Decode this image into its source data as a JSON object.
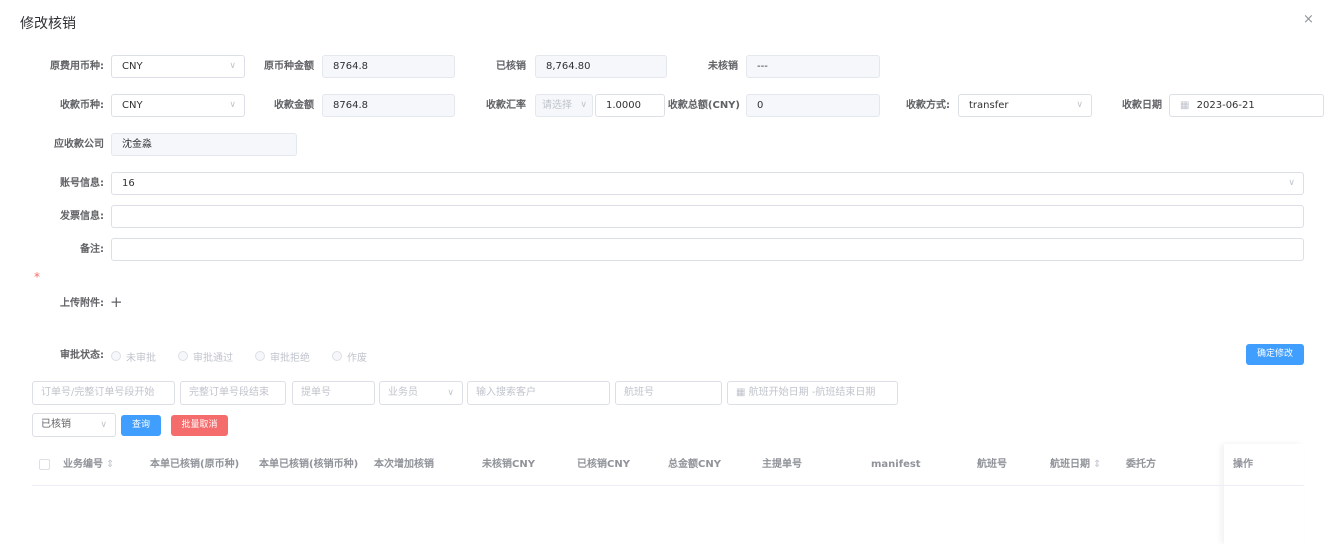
{
  "dialog": {
    "title": "修改核销",
    "close_icon": "×"
  },
  "row1": {
    "orig_currency": {
      "label": "原费用币种:",
      "value": "CNY"
    },
    "orig_amount": {
      "label": "原币种金额",
      "value": "8764.8"
    },
    "written_off": {
      "label": "已核销",
      "value": "8,764.80"
    },
    "not_written_off": {
      "label": "未核销",
      "value": "---"
    }
  },
  "row2": {
    "receipt_currency": {
      "label": "收款币种:",
      "value": "CNY"
    },
    "receipt_amount": {
      "label": "收款金额",
      "value": "8764.8"
    },
    "exchange_rate": {
      "label": "收款汇率",
      "select_placeholder": "请选择",
      "value": "1.0000"
    },
    "total_cny": {
      "label": "收款总额(CNY)",
      "value": "0"
    },
    "method": {
      "label": "收款方式:",
      "value": "transfer"
    },
    "date": {
      "label": "收款日期",
      "value": "2023-06-21"
    }
  },
  "company": {
    "label": "应收款公司",
    "value": "沈金淼"
  },
  "account": {
    "label": "账号信息:",
    "value": "16"
  },
  "invoice": {
    "label": "发票信息:",
    "value": ""
  },
  "remark": {
    "label": "备注:",
    "value": ""
  },
  "upload": {
    "required_mark": "*",
    "label": "上传附件:",
    "add_icon": "+"
  },
  "approval": {
    "label": "审批状态:",
    "options": [
      "未审批",
      "审批通过",
      "审批拒绝",
      "作废"
    ]
  },
  "confirm_button": "确定修改",
  "filters": {
    "order_no": "订单号/完整订单号段开始",
    "full_order_no": "完整订单号段结束",
    "bill_no": "提单号",
    "salesman": "业务员",
    "customer": "输入搜索客户",
    "flight_no": "航班号",
    "flight_date": "航班开始日期 -航班结束日期",
    "status_value": "已核销",
    "query_button": "查询",
    "batch_cancel_button": "批量取消"
  },
  "table": {
    "columns": [
      "业务编号",
      "本单已核销(原币种)",
      "本单已核销(核销币种)",
      "本次增加核销",
      "未核销CNY",
      "已核销CNY",
      "总金额CNY",
      "主提单号",
      "manifest",
      "航班号",
      "航班日期",
      "委托方",
      "操作"
    ]
  },
  "icons": {
    "sort": "⇕",
    "chevron": "∨",
    "calendar": "▦"
  },
  "colors": {
    "primary": "#409eff",
    "danger": "#f56c6c"
  }
}
